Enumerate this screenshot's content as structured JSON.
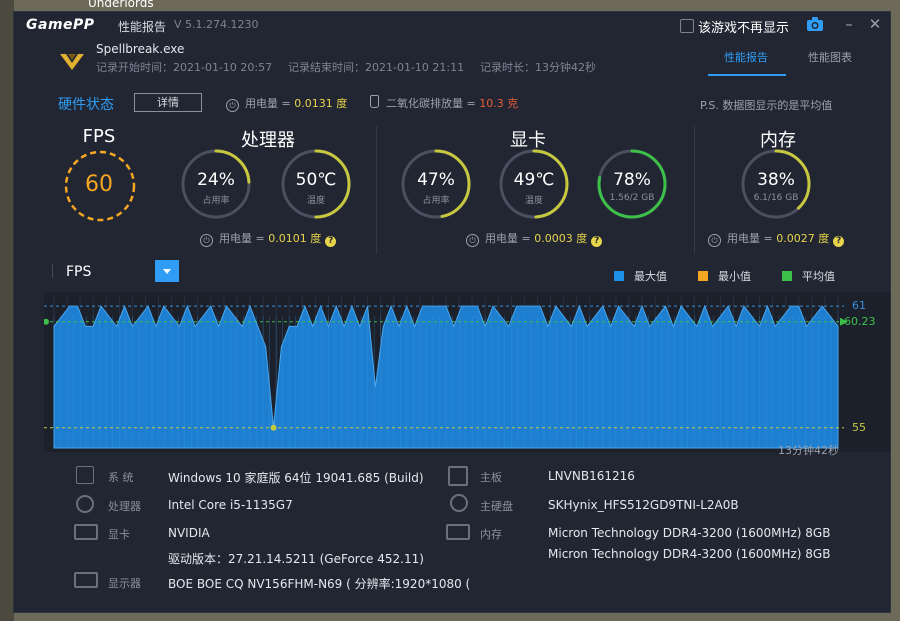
{
  "desktop": {
    "label": "Underlords"
  },
  "titlebar": {
    "logo": "GamePP",
    "title": "性能报告",
    "version": "V 5.1.274.1230",
    "hide_label": "该游戏不再显示"
  },
  "header": {
    "exe": "Spellbreak.exe",
    "record_start": "记录开始时间：2021-01-10 20:57",
    "record_end": "记录结束时间：2021-01-10 21:11",
    "record_duration": "记录时长：13分钟42秒",
    "tabs": [
      {
        "label": "性能报告",
        "active": true
      },
      {
        "label": "性能图表",
        "active": false
      }
    ]
  },
  "hardware": {
    "title": "硬件状态",
    "detail_label": "详情",
    "power_label": "用电量 =",
    "power_value": "0.0131",
    "power_unit": "度",
    "co2_label": "二氧化碳排放量 =",
    "co2_value": "10.3",
    "co2_unit": "克",
    "note": "P.S. 数据图显示的是平均值"
  },
  "fps": {
    "title": "FPS",
    "value": "60"
  },
  "cpu": {
    "title": "处理器",
    "usage": {
      "value": "24%",
      "label": "占用率",
      "pct": 24
    },
    "temp": {
      "value": "50℃",
      "label": "温度",
      "pct": 50
    },
    "power_label": "用电量 =",
    "power_value": "0.0101",
    "power_unit": "度"
  },
  "gpu": {
    "title": "显卡",
    "usage": {
      "value": "47%",
      "label": "占用率",
      "pct": 47
    },
    "temp": {
      "value": "49℃",
      "label": "温度",
      "pct": 49
    },
    "vram": {
      "value": "78%",
      "label": "1.56/2 GB",
      "pct": 78
    },
    "power_label": "用电量 =",
    "power_value": "0.0003",
    "power_unit": "度"
  },
  "memory": {
    "title": "内存",
    "usage": {
      "value": "38%",
      "label": "6.1/16 GB",
      "pct": 38
    },
    "power_label": "用电量 =",
    "power_value": "0.0027",
    "power_unit": "度"
  },
  "chart": {
    "metric": "FPS",
    "legend": [
      {
        "label": "最大值",
        "color": "#1e90e8"
      },
      {
        "label": "最小值",
        "color": "#f5a623"
      },
      {
        "label": "平均值",
        "color": "#3cc04a"
      }
    ],
    "max_label": "61",
    "avg_label": "60.23",
    "min_label": "55",
    "duration": "13分钟42秒",
    "colors": {
      "fill": "#1e7fd0",
      "max": "#3a8fd8",
      "avg": "#3cc04a",
      "min": "#c8c840"
    }
  },
  "chart_data": {
    "type": "area",
    "ylim": [
      54,
      61.5
    ],
    "max": 61,
    "avg": 60.23,
    "min": 55,
    "x": [
      0,
      2,
      3,
      4,
      5,
      6,
      8,
      9,
      10,
      12,
      13,
      14,
      16,
      17,
      18,
      20,
      21,
      22,
      24,
      25,
      26,
      27,
      28,
      29,
      30,
      31,
      32,
      33,
      34,
      35,
      36,
      37,
      38,
      39,
      40,
      41,
      42,
      43,
      44,
      45,
      46,
      47,
      48,
      50,
      51,
      52,
      54,
      55,
      56,
      58,
      59,
      60,
      62,
      63,
      64,
      66,
      67,
      68,
      70,
      71,
      72,
      74,
      75,
      76,
      78,
      79,
      80,
      82,
      83,
      84,
      86,
      87,
      88,
      90,
      91,
      92,
      94,
      95,
      96,
      98,
      100
    ],
    "values": [
      60,
      61,
      61,
      60,
      60,
      61,
      60,
      61,
      60,
      61,
      60,
      61,
      60,
      61,
      60,
      61,
      60,
      61,
      60,
      61,
      60,
      59,
      55,
      59,
      60,
      60,
      61,
      60,
      61,
      60,
      61,
      60,
      61,
      60,
      61,
      57,
      60,
      61,
      60,
      61,
      60,
      61,
      61,
      61,
      60,
      61,
      61,
      60,
      61,
      60,
      61,
      61,
      61,
      60,
      61,
      60,
      61,
      60,
      61,
      60,
      61,
      60,
      61,
      60,
      61,
      60,
      61,
      60,
      61,
      60,
      61,
      60,
      61,
      60,
      61,
      60,
      61,
      61,
      60,
      61,
      60
    ]
  },
  "specs": {
    "os": {
      "label": "系    统",
      "value": "Windows 10 家庭版 64位   19041.685 (Build)"
    },
    "cpu": {
      "label": "处理器",
      "value": "Intel Core i5-1135G7"
    },
    "gpu": {
      "label": "显卡",
      "value": "NVIDIA"
    },
    "driver": {
      "value": "驱动版本：27.21.14.5211 (GeForce 452.11)"
    },
    "display": {
      "label": "显示器",
      "value": "BOE BOE CQ NV156FHM-N69 ( 分辨率:1920*1080 ("
    },
    "board": {
      "label": "主板",
      "value": "LNVNB161216"
    },
    "disk": {
      "label": "主硬盘",
      "value": "SKHynix_HFS512GD9TNI-L2A0B"
    },
    "ram": {
      "label": "内存",
      "value1": "Micron Technology DDR4-3200 (1600MHz) 8GB",
      "value2": "Micron Technology DDR4-3200 (1600MHz) 8GB"
    }
  }
}
